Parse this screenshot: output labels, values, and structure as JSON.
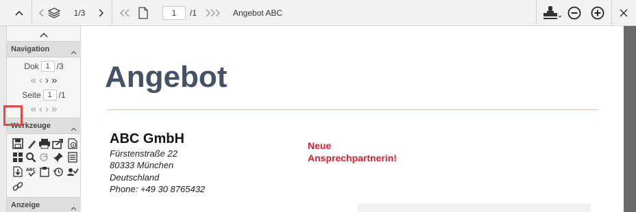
{
  "toolbar": {
    "doc_counter": "1/3",
    "page_input": "1",
    "page_total": "/1",
    "doc_name": "Angebot ABC"
  },
  "sidebar": {
    "navigation": {
      "title": "Navigation",
      "dok_label": "Dok",
      "dok_value": "1",
      "dok_total": "/3",
      "seite_label": "Seite",
      "seite_value": "1",
      "seite_total": "/1"
    },
    "tools": {
      "title": "Werkzeuge",
      "icons": [
        "save-icon",
        "edit-pen-icon",
        "print-icon",
        "export-icon",
        "info-doc-icon",
        "grid-icon",
        "search-icon",
        "redo-icon",
        "pin-icon",
        "list-doc-icon",
        "download-icon",
        "spellcheck-icon",
        "clipboard-icon",
        "history-icon",
        "approve-icon",
        "link-icon"
      ]
    },
    "display": {
      "title": "Anzeige"
    }
  },
  "document": {
    "title": "Angebot",
    "company": "ABC GmbH",
    "address": [
      "Fürstenstraße 22",
      "80333 München",
      "Deutschland",
      "Phone: +49 30 8765432"
    ],
    "notice_line1": "Neue",
    "notice_line2": "Ansprechpartnerin!"
  },
  "colors": {
    "accent_title": "#445166",
    "notice_red": "#e11b2c",
    "highlight_red": "#e04848"
  }
}
